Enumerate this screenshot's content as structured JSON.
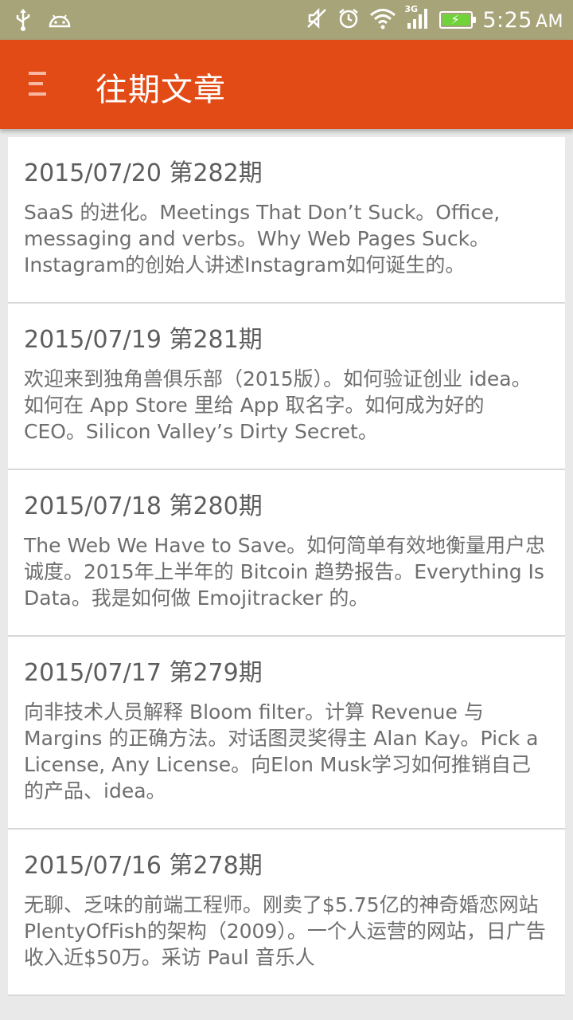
{
  "status_bar": {
    "time": "5:25",
    "ampm": "AM",
    "network": "3G",
    "left_icons": [
      "usb-icon",
      "android-debug-icon"
    ],
    "right_icons": [
      "mute-icon",
      "alarm-icon",
      "wifi-icon",
      "signal-icon",
      "battery-charging-icon"
    ],
    "battery_color": "#6fd33a"
  },
  "app_bar": {
    "title": "往期文章",
    "menu_icon": "hamburger-menu-icon",
    "color": "#e24b16"
  },
  "articles": [
    {
      "title": "2015/07/20 第282期",
      "summary": "SaaS 的进化。Meetings That Don’t Suck。Office, messaging and verbs。Why Web Pages Suck。Instagram的创始人讲述Instagram如何诞生的。"
    },
    {
      "title": "2015/07/19 第281期",
      "summary": "欢迎来到独角兽俱乐部（2015版）。如何验证创业 idea。如何在 App Store 里给 App 取名字。如何成为好的 CEO。Silicon Valley’s Dirty Secret。"
    },
    {
      "title": "2015/07/18 第280期",
      "summary": "The Web We Have to Save。如何简单有效地衡量用户忠诚度。2015年上半年的 Bitcoin 趋势报告。Everything Is Data。我是如何做 Emojitracker 的。"
    },
    {
      "title": "2015/07/17 第279期",
      "summary": "向非技术人员解释 Bloom filter。计算 Revenue 与 Margins 的正确方法。对话图灵奖得主 Alan Kay。Pick a License, Any License。向Elon Musk学习如何推销自己的产品、idea。"
    },
    {
      "title": "2015/07/16 第278期",
      "summary": "无聊、乏味的前端工程师。刚卖了$5.75亿的神奇婚恋网站PlentyOfFish的架构（2009）。一个人运营的网站，日广告收入近$50万。采访 Paul 音乐人"
    }
  ]
}
